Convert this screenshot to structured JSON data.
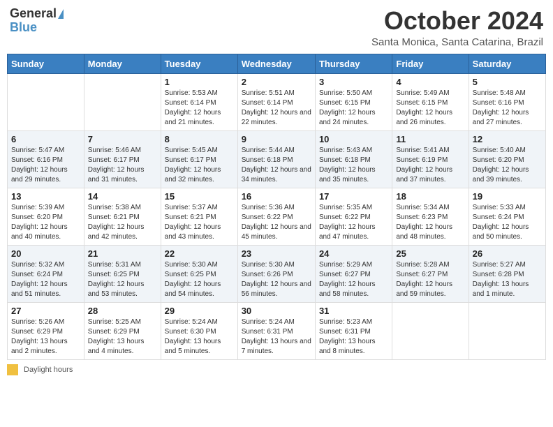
{
  "header": {
    "logo_general": "General",
    "logo_blue": "Blue",
    "month_title": "October 2024",
    "location": "Santa Monica, Santa Catarina, Brazil"
  },
  "days_of_week": [
    "Sunday",
    "Monday",
    "Tuesday",
    "Wednesday",
    "Thursday",
    "Friday",
    "Saturday"
  ],
  "weeks": [
    [
      {
        "day": "",
        "sunrise": "",
        "sunset": "",
        "daylight": ""
      },
      {
        "day": "",
        "sunrise": "",
        "sunset": "",
        "daylight": ""
      },
      {
        "day": "1",
        "sunrise": "Sunrise: 5:53 AM",
        "sunset": "Sunset: 6:14 PM",
        "daylight": "Daylight: 12 hours and 21 minutes."
      },
      {
        "day": "2",
        "sunrise": "Sunrise: 5:51 AM",
        "sunset": "Sunset: 6:14 PM",
        "daylight": "Daylight: 12 hours and 22 minutes."
      },
      {
        "day": "3",
        "sunrise": "Sunrise: 5:50 AM",
        "sunset": "Sunset: 6:15 PM",
        "daylight": "Daylight: 12 hours and 24 minutes."
      },
      {
        "day": "4",
        "sunrise": "Sunrise: 5:49 AM",
        "sunset": "Sunset: 6:15 PM",
        "daylight": "Daylight: 12 hours and 26 minutes."
      },
      {
        "day": "5",
        "sunrise": "Sunrise: 5:48 AM",
        "sunset": "Sunset: 6:16 PM",
        "daylight": "Daylight: 12 hours and 27 minutes."
      }
    ],
    [
      {
        "day": "6",
        "sunrise": "Sunrise: 5:47 AM",
        "sunset": "Sunset: 6:16 PM",
        "daylight": "Daylight: 12 hours and 29 minutes."
      },
      {
        "day": "7",
        "sunrise": "Sunrise: 5:46 AM",
        "sunset": "Sunset: 6:17 PM",
        "daylight": "Daylight: 12 hours and 31 minutes."
      },
      {
        "day": "8",
        "sunrise": "Sunrise: 5:45 AM",
        "sunset": "Sunset: 6:17 PM",
        "daylight": "Daylight: 12 hours and 32 minutes."
      },
      {
        "day": "9",
        "sunrise": "Sunrise: 5:44 AM",
        "sunset": "Sunset: 6:18 PM",
        "daylight": "Daylight: 12 hours and 34 minutes."
      },
      {
        "day": "10",
        "sunrise": "Sunrise: 5:43 AM",
        "sunset": "Sunset: 6:18 PM",
        "daylight": "Daylight: 12 hours and 35 minutes."
      },
      {
        "day": "11",
        "sunrise": "Sunrise: 5:41 AM",
        "sunset": "Sunset: 6:19 PM",
        "daylight": "Daylight: 12 hours and 37 minutes."
      },
      {
        "day": "12",
        "sunrise": "Sunrise: 5:40 AM",
        "sunset": "Sunset: 6:20 PM",
        "daylight": "Daylight: 12 hours and 39 minutes."
      }
    ],
    [
      {
        "day": "13",
        "sunrise": "Sunrise: 5:39 AM",
        "sunset": "Sunset: 6:20 PM",
        "daylight": "Daylight: 12 hours and 40 minutes."
      },
      {
        "day": "14",
        "sunrise": "Sunrise: 5:38 AM",
        "sunset": "Sunset: 6:21 PM",
        "daylight": "Daylight: 12 hours and 42 minutes."
      },
      {
        "day": "15",
        "sunrise": "Sunrise: 5:37 AM",
        "sunset": "Sunset: 6:21 PM",
        "daylight": "Daylight: 12 hours and 43 minutes."
      },
      {
        "day": "16",
        "sunrise": "Sunrise: 5:36 AM",
        "sunset": "Sunset: 6:22 PM",
        "daylight": "Daylight: 12 hours and 45 minutes."
      },
      {
        "day": "17",
        "sunrise": "Sunrise: 5:35 AM",
        "sunset": "Sunset: 6:22 PM",
        "daylight": "Daylight: 12 hours and 47 minutes."
      },
      {
        "day": "18",
        "sunrise": "Sunrise: 5:34 AM",
        "sunset": "Sunset: 6:23 PM",
        "daylight": "Daylight: 12 hours and 48 minutes."
      },
      {
        "day": "19",
        "sunrise": "Sunrise: 5:33 AM",
        "sunset": "Sunset: 6:24 PM",
        "daylight": "Daylight: 12 hours and 50 minutes."
      }
    ],
    [
      {
        "day": "20",
        "sunrise": "Sunrise: 5:32 AM",
        "sunset": "Sunset: 6:24 PM",
        "daylight": "Daylight: 12 hours and 51 minutes."
      },
      {
        "day": "21",
        "sunrise": "Sunrise: 5:31 AM",
        "sunset": "Sunset: 6:25 PM",
        "daylight": "Daylight: 12 hours and 53 minutes."
      },
      {
        "day": "22",
        "sunrise": "Sunrise: 5:30 AM",
        "sunset": "Sunset: 6:25 PM",
        "daylight": "Daylight: 12 hours and 54 minutes."
      },
      {
        "day": "23",
        "sunrise": "Sunrise: 5:30 AM",
        "sunset": "Sunset: 6:26 PM",
        "daylight": "Daylight: 12 hours and 56 minutes."
      },
      {
        "day": "24",
        "sunrise": "Sunrise: 5:29 AM",
        "sunset": "Sunset: 6:27 PM",
        "daylight": "Daylight: 12 hours and 58 minutes."
      },
      {
        "day": "25",
        "sunrise": "Sunrise: 5:28 AM",
        "sunset": "Sunset: 6:27 PM",
        "daylight": "Daylight: 12 hours and 59 minutes."
      },
      {
        "day": "26",
        "sunrise": "Sunrise: 5:27 AM",
        "sunset": "Sunset: 6:28 PM",
        "daylight": "Daylight: 13 hours and 1 minute."
      }
    ],
    [
      {
        "day": "27",
        "sunrise": "Sunrise: 5:26 AM",
        "sunset": "Sunset: 6:29 PM",
        "daylight": "Daylight: 13 hours and 2 minutes."
      },
      {
        "day": "28",
        "sunrise": "Sunrise: 5:25 AM",
        "sunset": "Sunset: 6:29 PM",
        "daylight": "Daylight: 13 hours and 4 minutes."
      },
      {
        "day": "29",
        "sunrise": "Sunrise: 5:24 AM",
        "sunset": "Sunset: 6:30 PM",
        "daylight": "Daylight: 13 hours and 5 minutes."
      },
      {
        "day": "30",
        "sunrise": "Sunrise: 5:24 AM",
        "sunset": "Sunset: 6:31 PM",
        "daylight": "Daylight: 13 hours and 7 minutes."
      },
      {
        "day": "31",
        "sunrise": "Sunrise: 5:23 AM",
        "sunset": "Sunset: 6:31 PM",
        "daylight": "Daylight: 13 hours and 8 minutes."
      },
      {
        "day": "",
        "sunrise": "",
        "sunset": "",
        "daylight": ""
      },
      {
        "day": "",
        "sunrise": "",
        "sunset": "",
        "daylight": ""
      }
    ]
  ],
  "footer": {
    "daylight_label": "Daylight hours"
  }
}
